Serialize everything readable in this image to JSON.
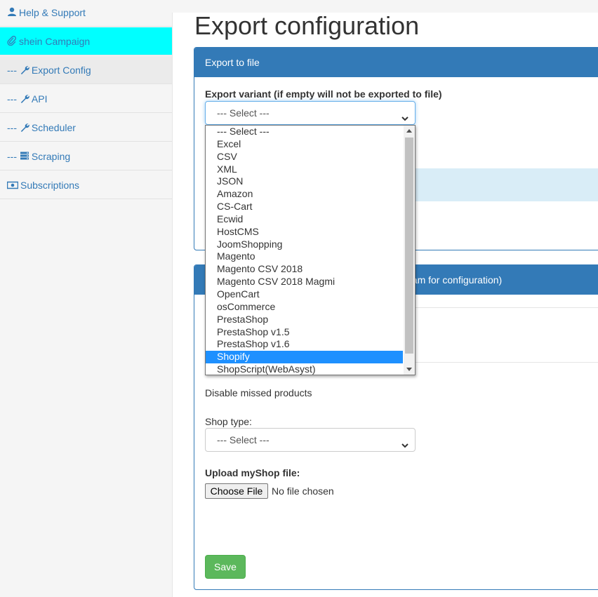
{
  "sidebar": {
    "items": [
      {
        "label": "Help & Support",
        "prefix": "",
        "icon": "user-icon"
      },
      {
        "label": "shein Campaign",
        "prefix": "",
        "icon": "paperclip-icon"
      },
      {
        "label": "Export Config",
        "prefix": "---",
        "icon": "wrench-icon"
      },
      {
        "label": "API",
        "prefix": "---",
        "icon": "wrench-icon"
      },
      {
        "label": "Scheduler",
        "prefix": "---",
        "icon": "wrench-icon"
      },
      {
        "label": "Scraping",
        "prefix": "---",
        "icon": "server-icon"
      },
      {
        "label": "Subscriptions",
        "prefix": "",
        "icon": "money-icon"
      }
    ]
  },
  "page": {
    "title": "Export configuration"
  },
  "export_panel": {
    "heading": "Export to file",
    "variant_label": "Export variant (if empty will not be exported to file)",
    "variant_value": "--- Select ---"
  },
  "dropdown": {
    "options": [
      "--- Select ---",
      "Excel",
      "CSV",
      "XML",
      "JSON",
      "Amazon",
      "CS-Cart",
      "Ecwid",
      "HostCMS",
      "JoomShopping",
      "Magento",
      "Magento CSV 2018",
      "Magento CSV 2018 Magmi",
      "OpenCart",
      "osCommerce",
      "PrestaShop",
      "PrestaShop v1.5",
      "PrestaShop v1.6",
      "Shopify",
      "ShopScript(WebAsyst)"
    ],
    "highlighted": "Shopify"
  },
  "shop_panel": {
    "heading_partial": "eam for configuration)",
    "disable_missed": "Disable missed products",
    "shop_type_label": "Shop type:",
    "shop_type_value": "--- Select ---",
    "upload_label": "Upload myShop file:",
    "choose_file": "Choose File",
    "no_file": "No file chosen",
    "save": "Save"
  },
  "colors": {
    "primary": "#337ab7",
    "active_sidebar": "#00ffff",
    "highlight": "#1e90ff",
    "success": "#5cb85c"
  }
}
